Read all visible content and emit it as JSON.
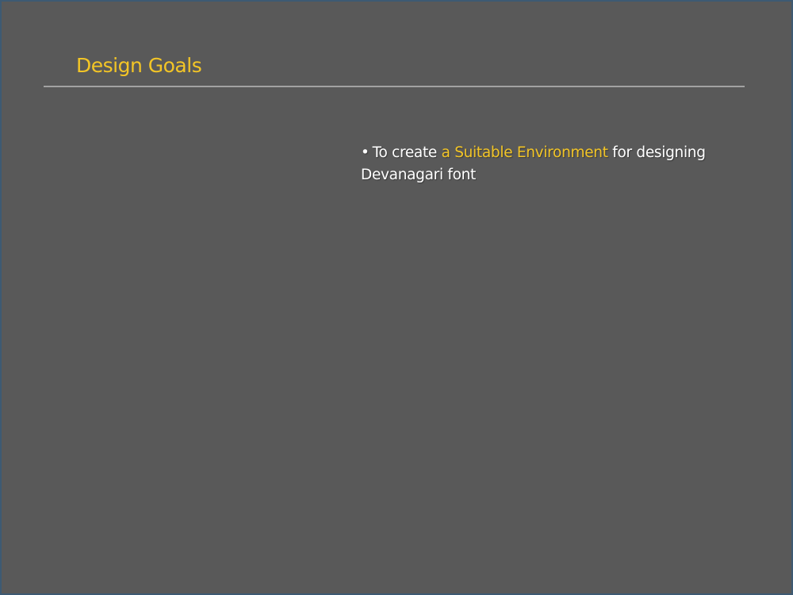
{
  "slide": {
    "title": "Design Goals",
    "bullets": [
      {
        "marker": "•",
        "before": "To create ",
        "highlight": "a Suitable Environment",
        "after": " for designing Devanagari font"
      }
    ]
  },
  "colors": {
    "frame": "#3d5a73",
    "background": "#595959",
    "title": "#f3c526",
    "highlight": "#f3c526",
    "text": "#ffffff",
    "divider": "#a2a2a2"
  }
}
